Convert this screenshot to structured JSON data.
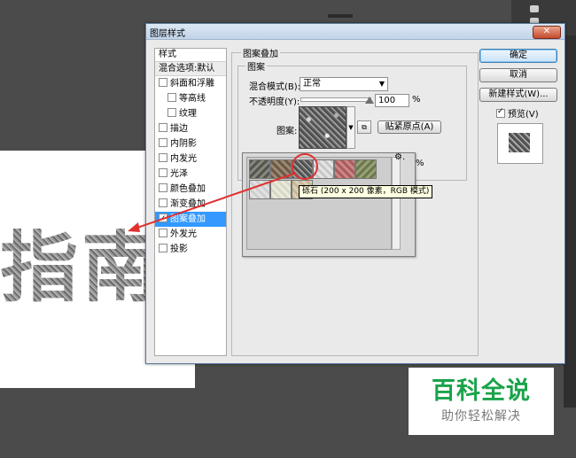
{
  "dialog": {
    "title": "图层样式",
    "close_label": "✕"
  },
  "style_list": {
    "header": "样式",
    "blend_options": "混合选项:默认",
    "items": [
      {
        "label": "斜面和浮雕",
        "checked": false,
        "indent": false
      },
      {
        "label": "等高线",
        "checked": false,
        "indent": true
      },
      {
        "label": "纹理",
        "checked": false,
        "indent": true
      },
      {
        "label": "描边",
        "checked": false,
        "indent": false
      },
      {
        "label": "内阴影",
        "checked": false,
        "indent": false
      },
      {
        "label": "内发光",
        "checked": false,
        "indent": false
      },
      {
        "label": "光泽",
        "checked": false,
        "indent": false
      },
      {
        "label": "颜色叠加",
        "checked": false,
        "indent": false
      },
      {
        "label": "渐变叠加",
        "checked": false,
        "indent": false
      },
      {
        "label": "图案叠加",
        "checked": true,
        "indent": false,
        "selected": true
      },
      {
        "label": "外发光",
        "checked": false,
        "indent": false
      },
      {
        "label": "投影",
        "checked": false,
        "indent": false
      }
    ]
  },
  "pattern_overlay": {
    "group_title": "图案叠加",
    "subgroup_title": "图案",
    "blend_mode_label": "混合模式(B):",
    "blend_mode_value": "正常",
    "opacity_label": "不透明度(Y):",
    "opacity_value": "100",
    "opacity_unit": "%",
    "opacity_fraction": 1.0,
    "pattern_label": "图案:",
    "snap_origin_label": "贴紧原点(A)",
    "scale_unit": "%"
  },
  "buttons": {
    "ok": "确定",
    "cancel": "取消",
    "new_style": "新建样式(W)...",
    "preview_label": "预览(V)",
    "preview_checked": true
  },
  "picker": {
    "tooltip": "砾石 (200 x 200 像素，RGB 模式)",
    "gear": "⚙."
  },
  "canvas": {
    "big_text": "指南"
  },
  "watermark": {
    "title": "百科全说",
    "subtitle": "助你轻松解决"
  },
  "colors": {
    "selection": "#3399ff",
    "annotation": "#e03030",
    "watermark_green": "#1aa34a"
  }
}
